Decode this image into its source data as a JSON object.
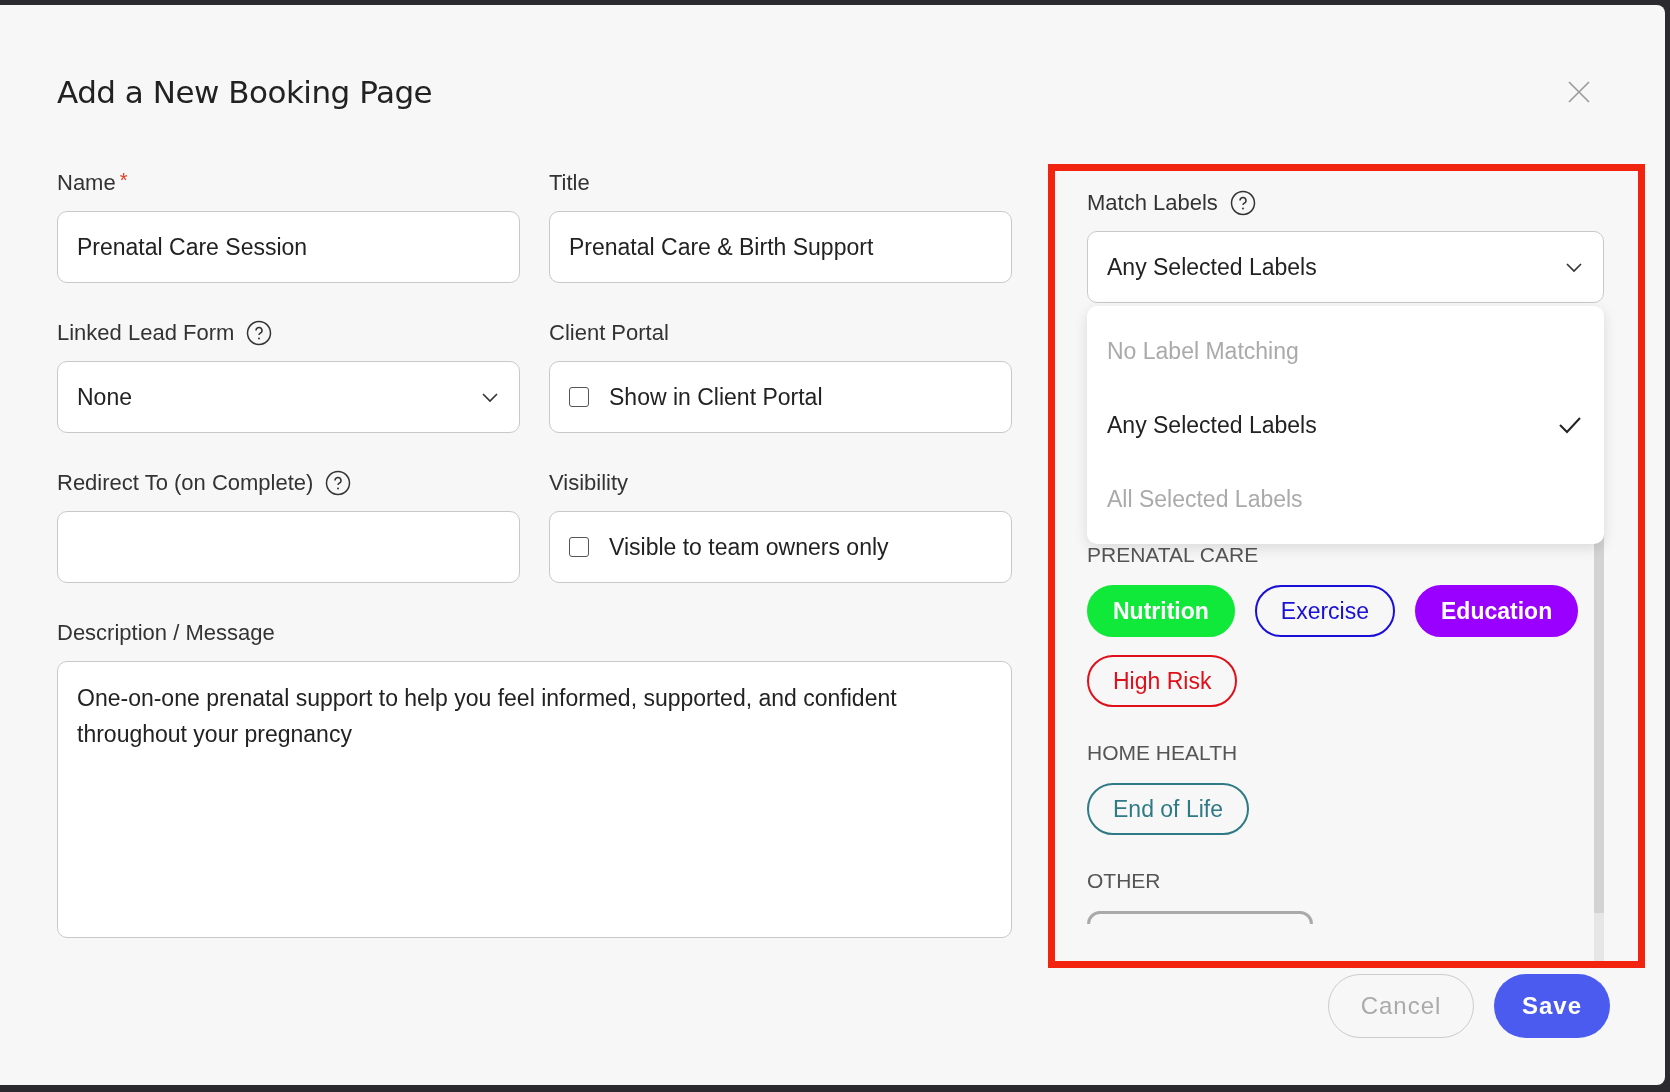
{
  "dialog": {
    "title": "Add a New Booking Page"
  },
  "fields": [
    {
      "kind": "text",
      "label": "Name",
      "required_mark": "*",
      "help": false,
      "value": "Prenatal Care Session"
    },
    {
      "kind": "text",
      "label": "Title",
      "help": false,
      "value": "Prenatal Care & Birth Support"
    },
    {
      "kind": "select",
      "label": "Linked Lead Form",
      "help": true,
      "value": "None"
    },
    {
      "kind": "checkbox",
      "label": "Client Portal",
      "help": false,
      "option": "Show in Client Portal",
      "checked": false
    },
    {
      "kind": "text",
      "label": "Redirect To (on Complete)",
      "help": true
    },
    {
      "kind": "checkbox",
      "label": "Visibility",
      "help": false,
      "option": "Visible to team owners only",
      "checked": false
    }
  ],
  "description": {
    "label": "Description / Message",
    "value": "One-on-one prenatal support to help you feel informed, supported, and confident throughout your pregnancy"
  },
  "match_labels": {
    "label": "Match Labels",
    "help": true,
    "value": "Any Selected Labels",
    "options": [
      {
        "label": "No Label Matching",
        "selected": false
      },
      {
        "label": "Any Selected Labels",
        "selected": true
      },
      {
        "label": "All Selected Labels",
        "selected": false
      }
    ],
    "groups": [
      {
        "heading": "PRENATAL CARE",
        "labels": [
          {
            "text": "Nutrition",
            "color": "#10e83a",
            "selected": true
          },
          {
            "text": "Exercise",
            "color": "#1a0fd6",
            "selected": false
          },
          {
            "text": "Education",
            "color": "#9900ff",
            "selected": true
          },
          {
            "text": "High Risk",
            "color": "#e0101a",
            "selected": false
          }
        ]
      },
      {
        "heading": "HOME HEALTH",
        "labels": [
          {
            "text": "End of Life",
            "color": "#2f7a84",
            "selected": false
          }
        ]
      },
      {
        "heading": "OTHER"
      }
    ]
  },
  "buttons": [
    {
      "kind": "secondary",
      "label": "Cancel"
    },
    {
      "kind": "primary",
      "label": "Save"
    }
  ]
}
